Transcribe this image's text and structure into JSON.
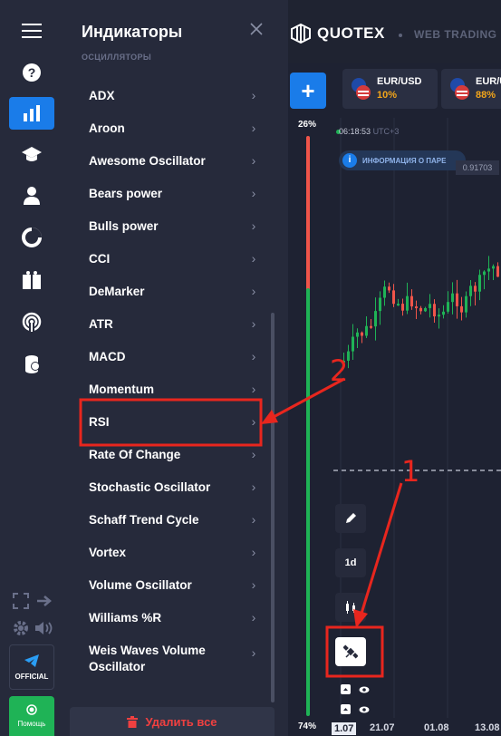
{
  "panel": {
    "title": "Индикаторы",
    "section": "ОСЦИЛЛЯТОРЫ",
    "items": [
      {
        "label": "ADX"
      },
      {
        "label": "Aroon"
      },
      {
        "label": "Awesome Oscillator"
      },
      {
        "label": "Bears power"
      },
      {
        "label": "Bulls power"
      },
      {
        "label": "CCI"
      },
      {
        "label": "DeMarker"
      },
      {
        "label": "ATR"
      },
      {
        "label": "MACD"
      },
      {
        "label": "Momentum"
      },
      {
        "label": "RSI"
      },
      {
        "label": "Rate Of Change"
      },
      {
        "label": "Stochastic Oscillator"
      },
      {
        "label": "Schaff Trend Cycle"
      },
      {
        "label": "Vortex"
      },
      {
        "label": "Volume Oscillator"
      },
      {
        "label": "Williams %R"
      },
      {
        "label": "Weis Waves Volume Oscillator"
      }
    ],
    "remove_all": "Удалить все"
  },
  "rail": {
    "official": "OFFICIAL",
    "help": "Помощь"
  },
  "header": {
    "logo": "QUOTEX",
    "web_trading": "WEB TRADING"
  },
  "assets": [
    {
      "name": "EUR/USD",
      "payout": "10%"
    },
    {
      "name": "EUR/USD",
      "payout": "88%"
    }
  ],
  "chart": {
    "sentiment_up": "26%",
    "sentiment_down": "74%",
    "time": "06:18:53",
    "timezone": "UTC+3",
    "info": "ИНФОРМАЦИЯ О ПАРЕ",
    "price": "0.91703",
    "timeframe": "1d",
    "dates": [
      "1.07",
      "21.07",
      "01.08",
      "13.08"
    ]
  },
  "annotations": {
    "label_1": "1",
    "label_2": "2",
    "color": "#e8261e"
  },
  "colors": {
    "accent": "#1a7ce9",
    "up": "#1fb356",
    "down": "#f0554a",
    "payout": "#f2a51a"
  }
}
